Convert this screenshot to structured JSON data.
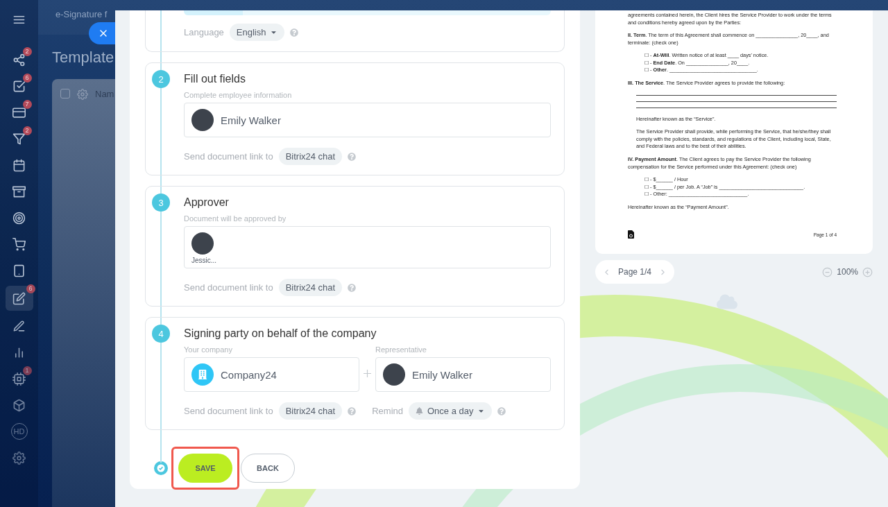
{
  "app": {
    "header_title": "e-Signature f",
    "page_title": "Template",
    "select_all_checked": false,
    "table_header": "Nam"
  },
  "sidebar": {
    "items": [
      {
        "badge": "2",
        "selected": false
      },
      {
        "badge": "6",
        "selected": false
      },
      {
        "badge": "7",
        "selected": false
      },
      {
        "badge": "2",
        "selected": false
      },
      {
        "selected": false
      },
      {
        "selected": false
      },
      {
        "selected": false
      },
      {
        "selected": false
      },
      {
        "selected": false
      },
      {
        "badge": "6",
        "selected": true
      },
      {
        "selected": false
      },
      {
        "selected": false
      },
      {
        "badge": "1",
        "selected": false
      },
      {
        "selected": false
      },
      {
        "label": "HD",
        "selected": false
      },
      {
        "selected": false
      }
    ]
  },
  "form": {
    "language": {
      "label": "Language",
      "value": "English"
    },
    "steps": [
      {
        "kind": "employee",
        "number": "2",
        "title": "Fill out fields",
        "field_label": "Complete employee information",
        "person": "Emily Walker",
        "send_label": "Send document link to",
        "send_value": "Bitrix24 chat"
      },
      {
        "kind": "approver",
        "number": "3",
        "title": "Approver",
        "field_label": "Document will be approved by",
        "person": "Jessic...",
        "send_label": "Send document link to",
        "send_value": "Bitrix24 chat"
      },
      {
        "kind": "company",
        "number": "4",
        "title": "Signing party on behalf of the company",
        "company_label": "Your company",
        "company": "Company24",
        "rep_label": "Representative",
        "person": "Emily Walker",
        "send_label": "Send document link to",
        "send_value": "Bitrix24 chat",
        "remind_label": "Remind",
        "remind_value": "Once a day"
      }
    ],
    "buttons": {
      "save": {
        "label": "SAVE",
        "highlighted": true
      },
      "back": {
        "label": "BACK"
      }
    }
  },
  "preview": {
    "blocks": [
      {
        "kind": "p",
        "text": "agreements contained herein, the Client hires the Service Provider to work under the terms and conditions hereby agreed upon by the Parties:"
      },
      {
        "kind": "p",
        "text": "**II. Term**. The term of this Agreement shall commence on _______________, 20____, and terminate: (check one)"
      },
      {
        "kind": "list",
        "items": [
          "☐ - **At-Will**. Written notice of at least ____ days' notice.",
          "☐ - **End Date**. On _______________, 20____.",
          "☐ - **Other**. _______________________________."
        ]
      },
      {
        "kind": "p",
        "text": "**III. The Service**. The Service Provider agrees to provide the following:"
      },
      {
        "kind": "rules"
      },
      {
        "kind": "indent",
        "text": "Hereinafter known as the “Service”."
      },
      {
        "kind": "indent",
        "text": "The Service Provider shall provide, while performing the Service, that he/she/they shall comply with the policies, standards, and regulations of the Client, including local, State, and Federal laws and to the best of their abilities."
      },
      {
        "kind": "p",
        "text": "**IV. Payment Amount**. The Client agrees to pay the Service Provider the following compensation for the Service performed under this Agreement: (check one)"
      },
      {
        "kind": "list",
        "items": [
          "☐ - $______ / Hour",
          "☐ - $______ / per Job. A “Job” is ______________________________.",
          "☐ - Other: ____________________________."
        ]
      },
      {
        "kind": "p",
        "text": "Hereinafter known as the “Payment Amount”."
      }
    ],
    "page_footer": "Page 1 of 4",
    "page_nav": "Page 1/4",
    "zoom": "100%"
  }
}
